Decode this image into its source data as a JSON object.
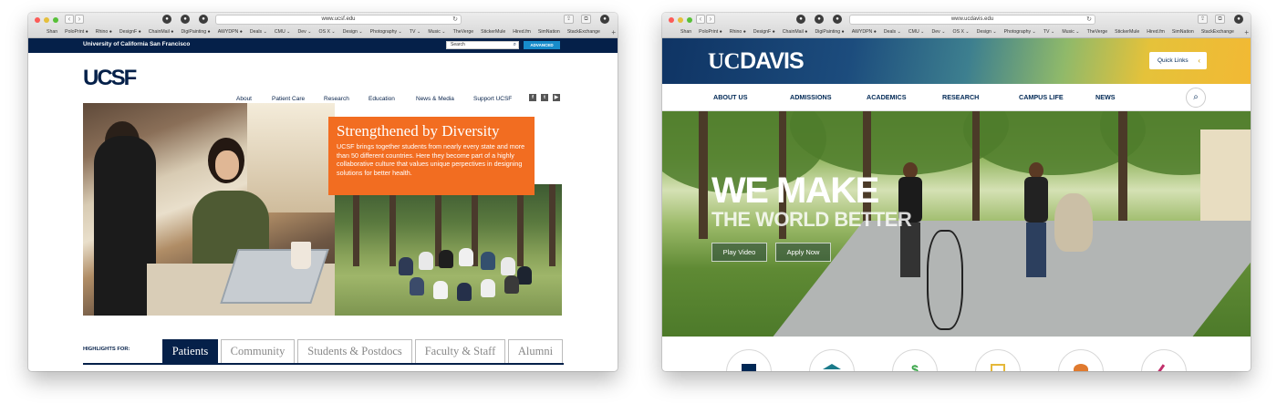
{
  "windows": [
    {
      "url": "www.ucsf.edu",
      "bookmarks": [
        "Shan",
        "PoloPrint ●",
        "Rhino ●",
        "DesignF ●",
        "ChainMail ●",
        "DigiPainting ●",
        "AWYDPN ●",
        "Deals ⌄",
        "CMU ⌄",
        "Dev ⌄",
        "OS X ⌄",
        "Design ⌄",
        "Photography ⌄",
        "TV ⌄",
        "Music ⌄",
        "TheVerge",
        "StickerMule",
        "Hired.fm",
        "SimNation",
        "StackExchange"
      ]
    },
    {
      "url": "www.ucdavis.edu",
      "bookmarks": [
        "Shan",
        "PoloPrint ●",
        "Rhino ●",
        "DesignF ●",
        "ChainMail ●",
        "DigiPainting ●",
        "AWYDPN ●",
        "Deals ⌄",
        "CMU ⌄",
        "Dev ⌄",
        "OS X ⌄",
        "Design ⌄",
        "Photography ⌄",
        "TV ⌄",
        "Music ⌄",
        "TheVerge",
        "StickerMule",
        "Hired.fm",
        "SimNation",
        "StackExchange"
      ]
    }
  ],
  "ucsf": {
    "university_name": "University of California San Francisco",
    "search_placeholder": "Search",
    "advanced_label": "ADVANCED",
    "logo": "UCSF",
    "nav": [
      "About",
      "Patient Care",
      "Research",
      "Education",
      "News & Media",
      "Support UCSF"
    ],
    "social_icons": [
      "facebook-icon",
      "twitter-icon",
      "youtube-icon"
    ],
    "social_glyphs": [
      "f",
      "t",
      "▶"
    ],
    "callout_title": "Strengthened by Diversity",
    "callout_body": "UCSF brings together students from nearly every state and more than 50 different countries. Here they become part of a highly collaborative culture that values unique perpectives in designing solutions for better health.",
    "highlights_label": "HIGHLIGHTS FOR:",
    "highlight_tabs": [
      "Patients",
      "Community",
      "Students & Postdocs",
      "Faculty & Staff",
      "Alumni"
    ],
    "active_tab": "Patients",
    "colors": {
      "navy": "#052049",
      "orange": "#f26d21",
      "advanced_blue": "#178ccb"
    }
  },
  "ucdavis": {
    "logo_uc": "UC",
    "logo_davis": "DAVIS",
    "quick_links": "Quick Links",
    "nav": [
      "ABOUT US",
      "ADMISSIONS",
      "ACADEMICS",
      "RESEARCH",
      "CAMPUS LIFE",
      "NEWS"
    ],
    "hero_line1": "WE MAKE",
    "hero_line2": "THE WORLD BETTER",
    "buttons": [
      "Play Video",
      "Apply Now"
    ],
    "colors": {
      "navy": "#002855",
      "gold": "#c99700"
    }
  }
}
